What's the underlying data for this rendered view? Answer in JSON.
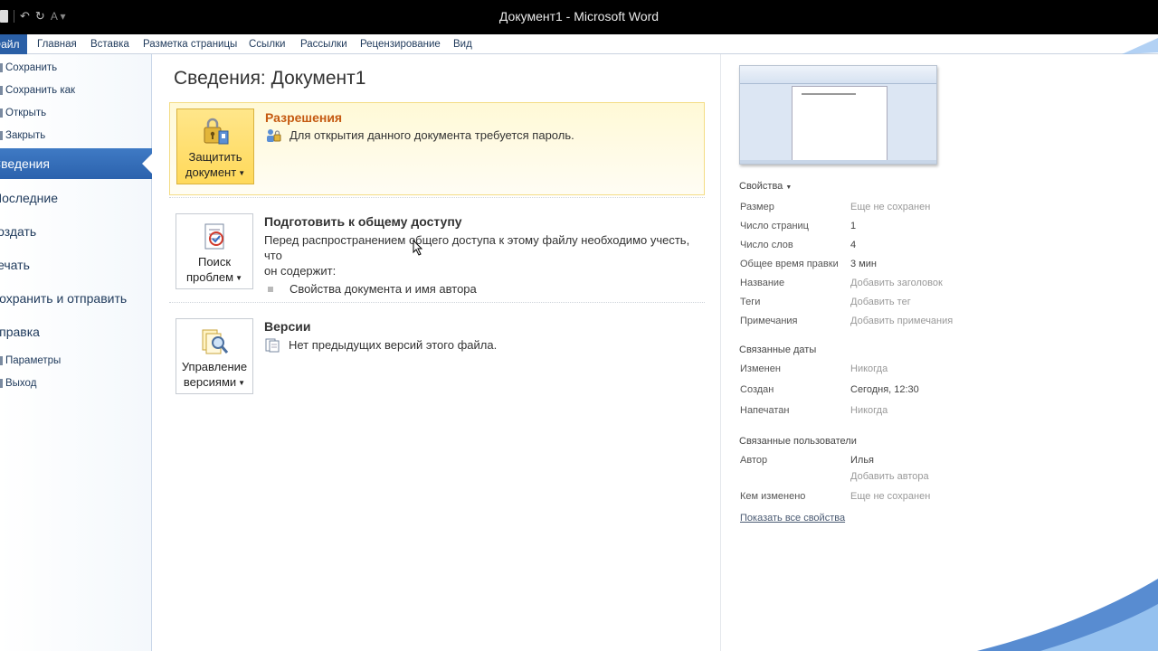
{
  "window": {
    "title": "Документ1 - Microsoft Word"
  },
  "quick_access": [
    "save-icon",
    "undo-icon",
    "redo-icon",
    "customize-icon"
  ],
  "ribbon": {
    "file_tab": "Файл",
    "tabs": [
      "Главная",
      "Вставка",
      "Разметка страницы",
      "Ссылки",
      "Рассылки",
      "Рецензирование",
      "Вид"
    ]
  },
  "nav": {
    "small_items_top": [
      "Сохранить",
      "Сохранить как",
      "Открыть",
      "Закрыть"
    ],
    "big_items": [
      "Сведения",
      "Последние",
      "Создать",
      "Печать",
      "Сохранить и отправить",
      "Справка"
    ],
    "selected": "Сведения",
    "small_items_bottom": [
      "Параметры",
      "Выход"
    ]
  },
  "main": {
    "title": "Сведения: Документ1",
    "permissions": {
      "button_line1": "Защитить",
      "button_line2": "документ",
      "heading": "Разрешения",
      "text": "Для открытия данного документа требуется пароль."
    },
    "prepare": {
      "button_line1": "Поиск",
      "button_line2": "проблем",
      "heading": "Подготовить к общему доступу",
      "text_line1": "Перед распространением общего доступа к этому файлу необходимо учесть, что",
      "text_line2": "он содержит:",
      "bullet": "Свойства документа и имя автора"
    },
    "versions": {
      "button_line1": "Управление",
      "button_line2": "версиями",
      "heading": "Версии",
      "text": "Нет предыдущих версий этого файла."
    }
  },
  "properties": {
    "header": "Свойства",
    "items": [
      {
        "key": "Размер",
        "value": "Еще не сохранен"
      },
      {
        "key": "Число страниц",
        "value": "1"
      },
      {
        "key": "Число слов",
        "value": "4"
      },
      {
        "key": "Общее время правки",
        "value": "3 мин"
      },
      {
        "key": "Название",
        "value": "Добавить заголовок"
      },
      {
        "key": "Теги",
        "value": "Добавить тег"
      },
      {
        "key": "Примечания",
        "value": "Добавить примечания"
      }
    ],
    "dates_header": "Связанные даты",
    "dates": [
      {
        "key": "Изменен",
        "value": "Никогда"
      },
      {
        "key": "Создан",
        "value": "Сегодня, 12:30"
      },
      {
        "key": "Напечатан",
        "value": "Никогда"
      }
    ],
    "people_header": "Связанные пользователи",
    "author_key": "Автор",
    "author_value": "Илья",
    "add_author": "Добавить автора",
    "modified_by_key": "Кем изменено",
    "modified_by_value": "Еще не сохранен",
    "show_all": "Показать все свойства"
  },
  "colors": {
    "accent": "#2b62ad",
    "permission_heading": "#c55a11",
    "highlight": "#ffd95a"
  }
}
